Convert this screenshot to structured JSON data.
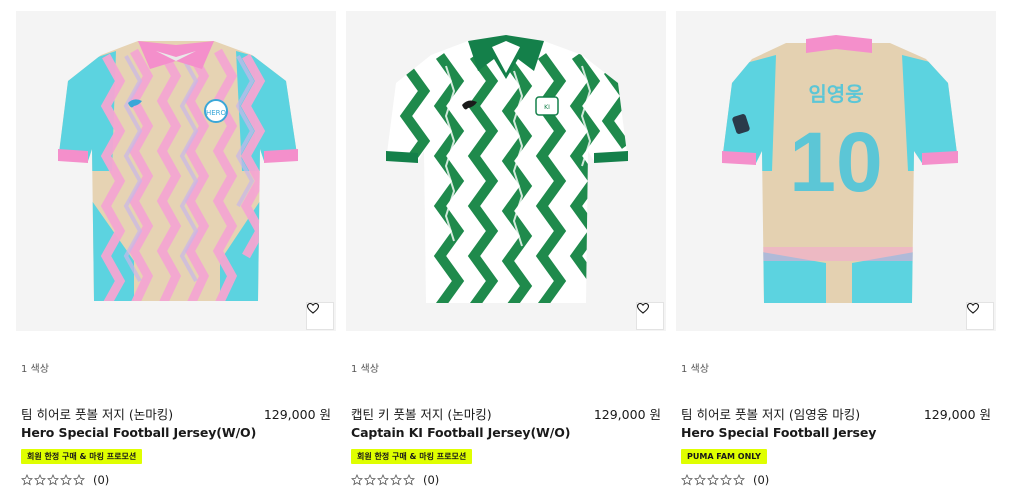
{
  "products": [
    {
      "color_count": "1 색상",
      "name_ko": "팀 히어로 풋볼 저지 (논마킹)",
      "price": "129,000 원",
      "name_en": "Hero Special Football Jersey(W/O)",
      "badge": "회원 한정 구매 & 마킹 프로모션",
      "reviews": "(0)",
      "image_icon": "jersey-pink-blue-zigzag-image"
    },
    {
      "color_count": "1 색상",
      "name_ko": "캡틴 키 풋볼 저지 (논마킹)",
      "price": "129,000 원",
      "name_en": "Captain KI Football Jersey(W/O)",
      "badge": "회원 한정 구매 & 마킹 프로모션",
      "reviews": "(0)",
      "image_icon": "jersey-green-white-zigzag-image"
    },
    {
      "color_count": "1 색상",
      "name_ko": "팀 히어로 풋볼 저지 (임영웅 마킹)",
      "price": "129,000 원",
      "name_en": "Hero Special Football Jersey",
      "badge": "PUMA FAM ONLY",
      "back_name": "임영웅",
      "back_number": "10",
      "reviews": "(0)",
      "image_icon": "jersey-beige-back-number-image"
    }
  ],
  "colors": {
    "badge_bg": "#dfff00",
    "card_bg": "#f4f4f4",
    "text": "#191919"
  }
}
